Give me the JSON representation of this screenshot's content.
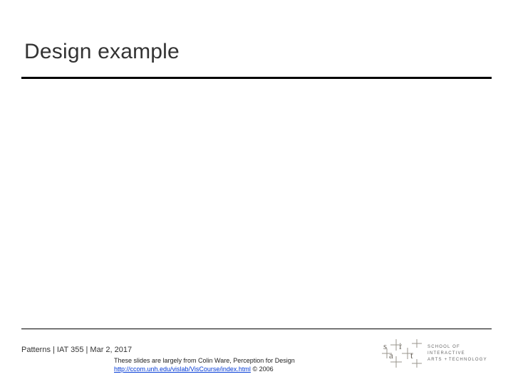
{
  "slide": {
    "title": "Design example"
  },
  "footer": {
    "line": "Patterns  |  IAT 355  |  Mar 2, 2017",
    "credit_prefix": "These slides are largely from Colin Ware, Perception for Design",
    "credit_link": "http://ccom.unh.edu/vislab/VisCourse/index.html",
    "credit_suffix": " © 2006"
  },
  "logo": {
    "line1": "SCHOOL OF INTERACTIVE",
    "line2_a": "ARTS ",
    "line2_amp": "+",
    "line2_b": " TECHNOLOGY"
  }
}
